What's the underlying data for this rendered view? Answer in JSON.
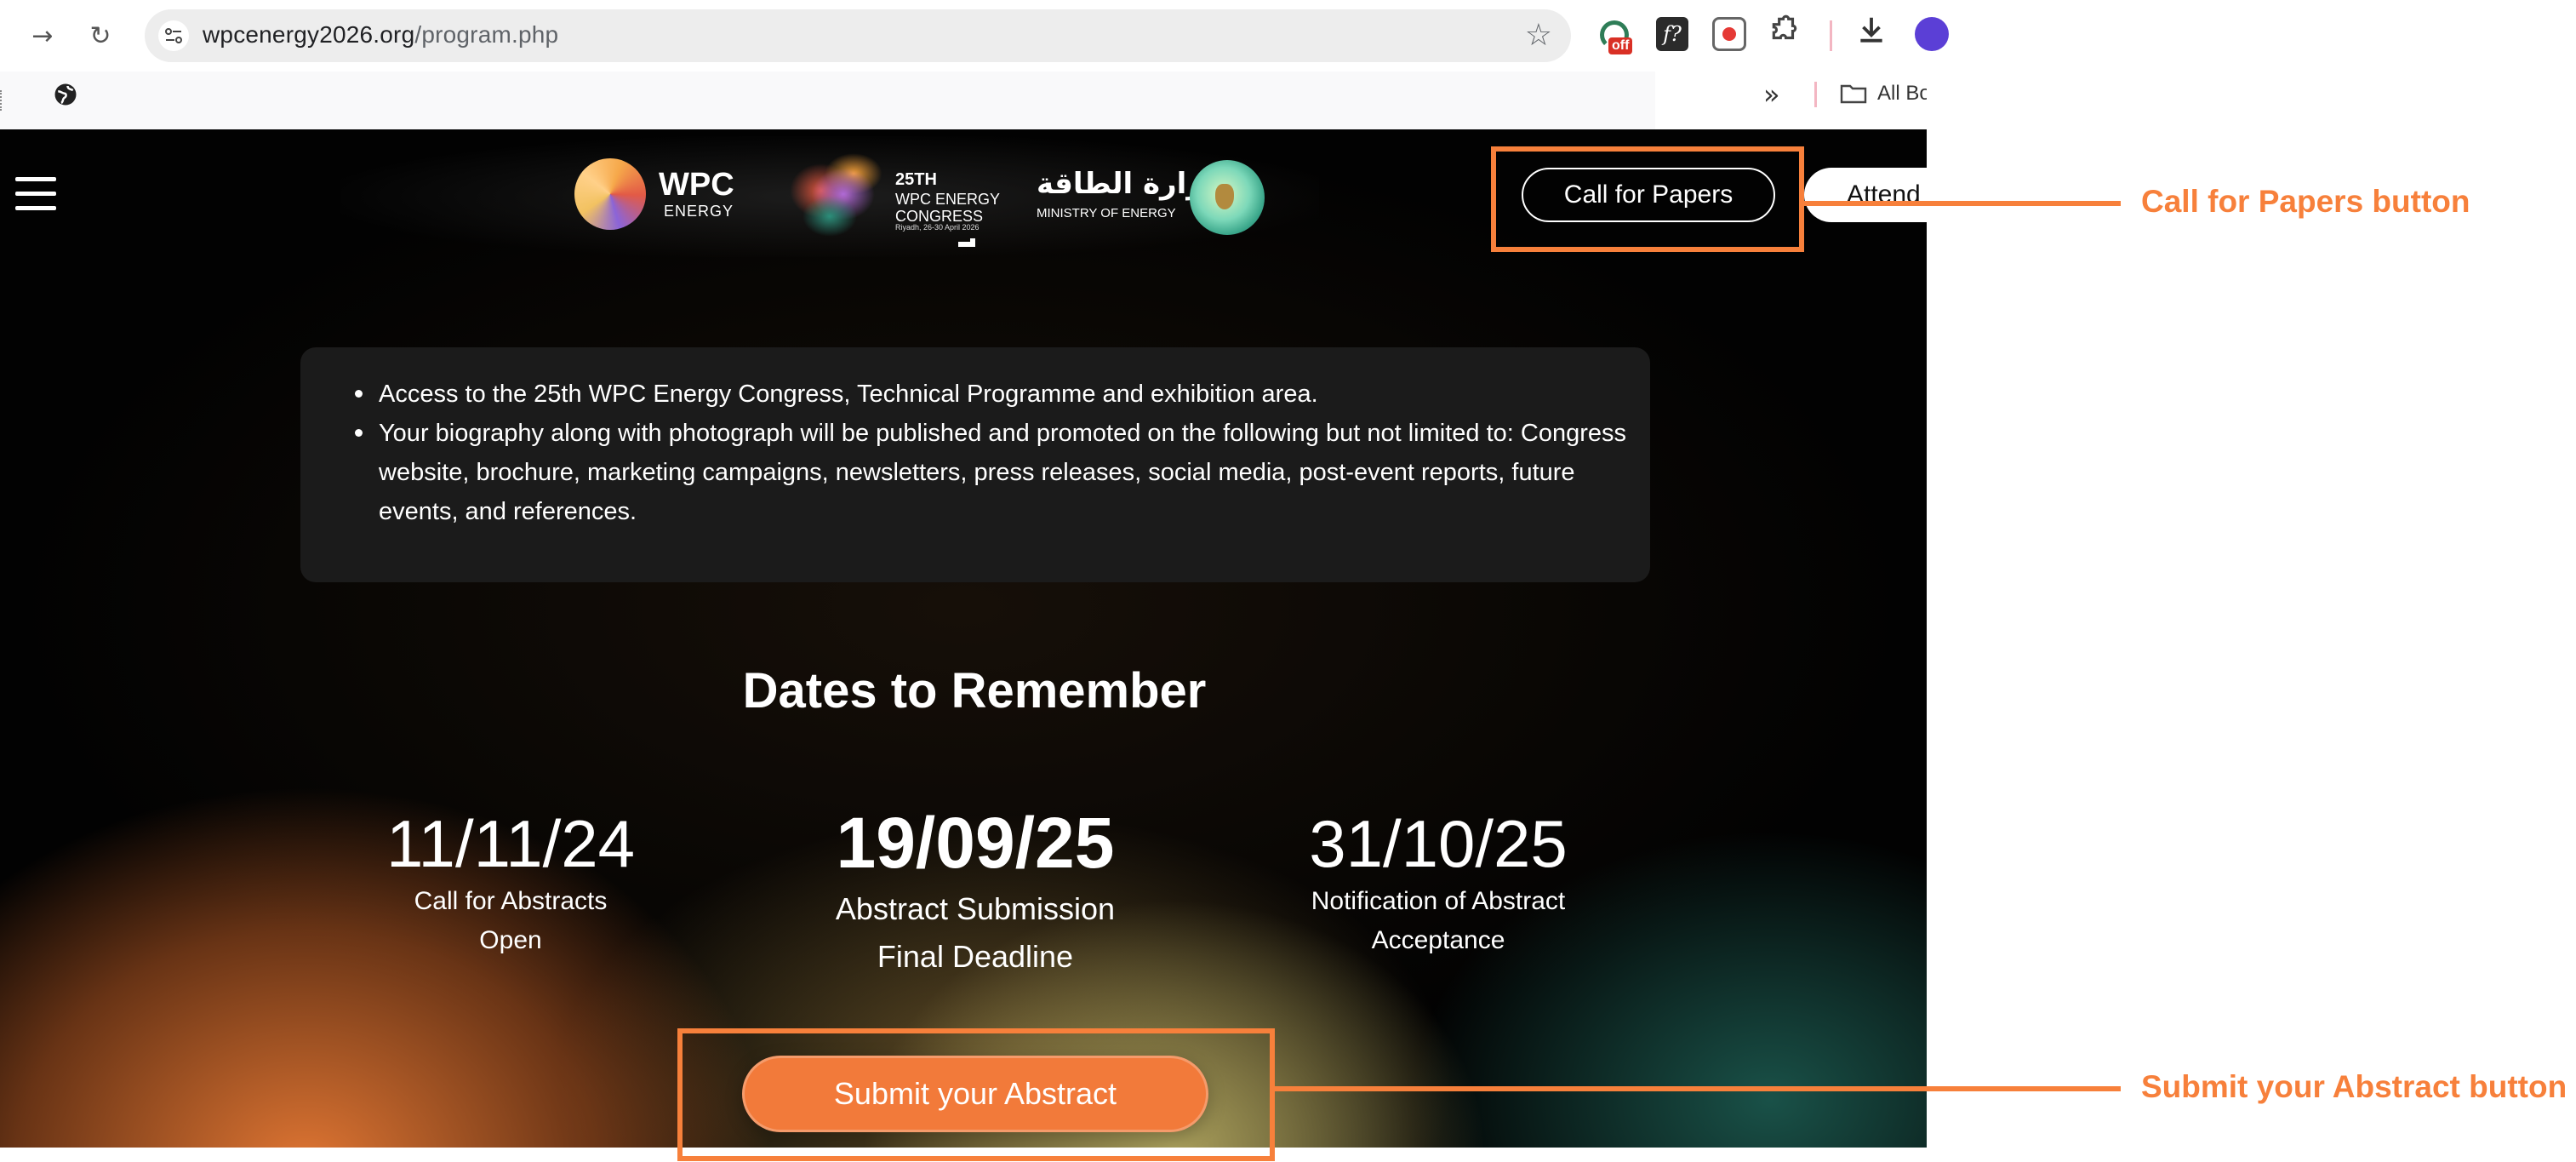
{
  "browser": {
    "url_domain": "wpcenergy2026.org",
    "url_path": "/program.php",
    "extension_badge": "off",
    "extension_fx_label": "f?",
    "bookmarks_overflow": "»",
    "all_bookmarks_label": "All Bo"
  },
  "header": {
    "wpc_logo": "WPC",
    "wpc_logo_sub": "ENERGY",
    "congress_number": "25TH",
    "congress_line1": "WPC ENERGY",
    "congress_line2": "CONGRESS",
    "congress_dates": "Riyadh, 26-30 April 2026",
    "ministry_arabic": "وزارة الطاقة",
    "ministry_english": "MINISTRY OF ENERGY",
    "cfp_button": "Call for Papers",
    "attend_button": "Attend"
  },
  "benefits": [
    "Access to the 25th WPC Energy Congress, Technical Programme and exhibition area.",
    "Your biography along with photograph will be published and promoted on the following but not limited to: Congress website, brochure, marketing campaigns, newsletters, press releases, social media, post-event reports, future events, and references."
  ],
  "dates_section": {
    "title": "Dates to Remember",
    "items": [
      {
        "date": "11/11/24",
        "label_line1": "Call for Abstracts",
        "label_line2": "Open"
      },
      {
        "date": "19/09/25",
        "label_line1": "Abstract Submission",
        "label_line2": "Final Deadline"
      },
      {
        "date": "31/10/25",
        "label_line1": "Notification of Abstract",
        "label_line2": "Acceptance"
      }
    ],
    "submit_button": "Submit your Abstract"
  },
  "annotations": {
    "cfp_callout": "Call for Papers button",
    "submit_callout": "Submit your Abstract button",
    "color": "#f7803b"
  },
  "colors": {
    "accent_orange": "#f27a3a",
    "page_background": "#020202",
    "card_background": "#1b1b1b"
  }
}
